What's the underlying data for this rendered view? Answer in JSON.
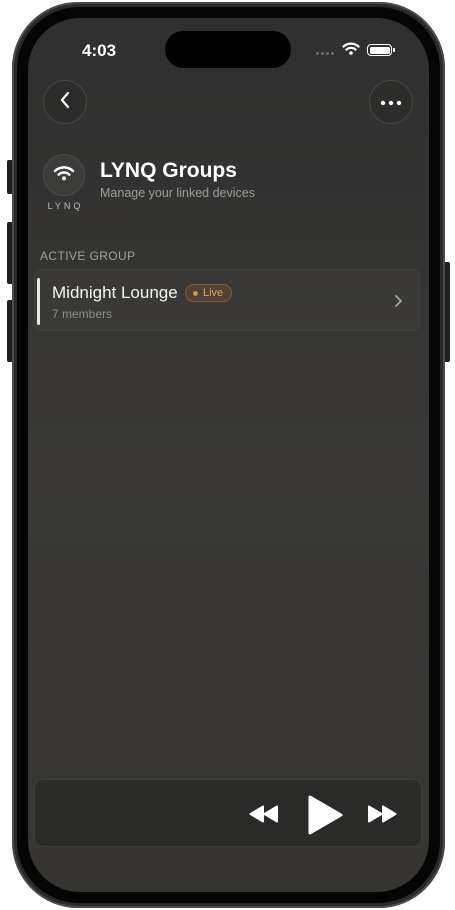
{
  "status_bar": {
    "time": "4:03"
  },
  "header": {
    "brand_logo_text": "LYNQ",
    "title": "LYNQ Groups",
    "subtitle": "Manage your linked devices"
  },
  "section": {
    "label": "ACTIVE GROUP"
  },
  "active_group": {
    "name": "Midnight Lounge",
    "badge": "Live",
    "members": "7 members"
  },
  "player": {
    "state": "paused"
  },
  "icons": {
    "back": "chevron-left-icon",
    "more": "ellipsis-icon",
    "logo": "wifi-icon",
    "row": "chevron-right-icon",
    "rewind": "rewind-icon",
    "play": "play-icon",
    "forward": "fast-forward-icon"
  },
  "colors": {
    "accent": "#e5a45b",
    "background": "#353432",
    "text": "#ffffff"
  }
}
